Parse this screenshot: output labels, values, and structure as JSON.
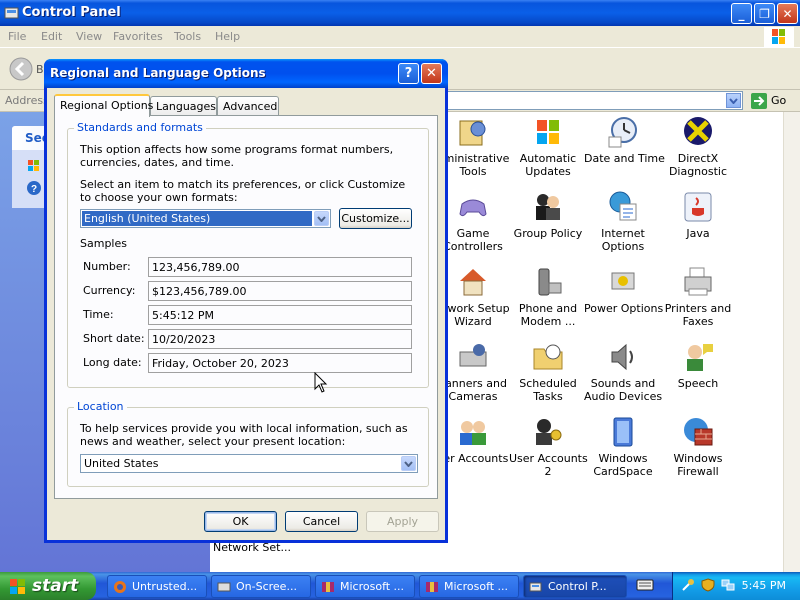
{
  "window": {
    "title": "Control Panel",
    "menu": [
      "File",
      "Edit",
      "View",
      "Favorites",
      "Tools",
      "Help"
    ],
    "back_label": "B",
    "address_label": "Address",
    "go_label": "Go",
    "side_header": "See"
  },
  "items": [
    {
      "label": "dministrative\nTools"
    },
    {
      "label": "Automatic\nUpdates"
    },
    {
      "label": "Date and Time"
    },
    {
      "label": "DirectX\nDiagnostic"
    },
    {
      "label": "Game\nControllers"
    },
    {
      "label": "Group Policy"
    },
    {
      "label": "Internet\nOptions"
    },
    {
      "label": "Java"
    },
    {
      "label": "etwork Setup\nWizard"
    },
    {
      "label": "Phone and\nModem ..."
    },
    {
      "label": "Power Options"
    },
    {
      "label": "Printers and\nFaxes"
    },
    {
      "label": "canners and\nCameras"
    },
    {
      "label": "Scheduled\nTasks"
    },
    {
      "label": "Sounds and\nAudio Devices"
    },
    {
      "label": "Speech"
    },
    {
      "label": "ser Accounts"
    },
    {
      "label": "User Accounts\n2"
    },
    {
      "label": "Windows\nCardSpace"
    },
    {
      "label": "Windows\nFirewall"
    }
  ],
  "bottom_item": "Network Set...",
  "dialog": {
    "title": "Regional and Language Options",
    "help": "?",
    "close": "✕",
    "tabs": [
      "Regional Options",
      "Languages",
      "Advanced"
    ],
    "standards_title": "Standards and formats",
    "standards_desc": "This option affects how some programs format numbers, currencies, dates, and time.",
    "select_desc": "Select an item to match its preferences, or click Customize to choose your own formats:",
    "format_value": "English (United States)",
    "customize": "Customize...",
    "samples_title": "Samples",
    "samples": [
      {
        "label": "Number:",
        "value": "123,456,789.00"
      },
      {
        "label": "Currency:",
        "value": "$123,456,789.00"
      },
      {
        "label": "Time:",
        "value": "5:45:12 PM"
      },
      {
        "label": "Short date:",
        "value": "10/20/2023"
      },
      {
        "label": "Long date:",
        "value": "Friday, October 20, 2023"
      }
    ],
    "location_title": "Location",
    "location_desc": "To help services provide you with local information, such as news and weather, select your present location:",
    "location_value": "United States",
    "ok": "OK",
    "cancel": "Cancel",
    "apply": "Apply"
  },
  "taskbar": {
    "start": "start",
    "tasks": [
      "Untrusted...",
      "On-Scree...",
      "Microsoft ...",
      "Microsoft ...",
      "Control P..."
    ],
    "clock": "5:45 PM"
  }
}
